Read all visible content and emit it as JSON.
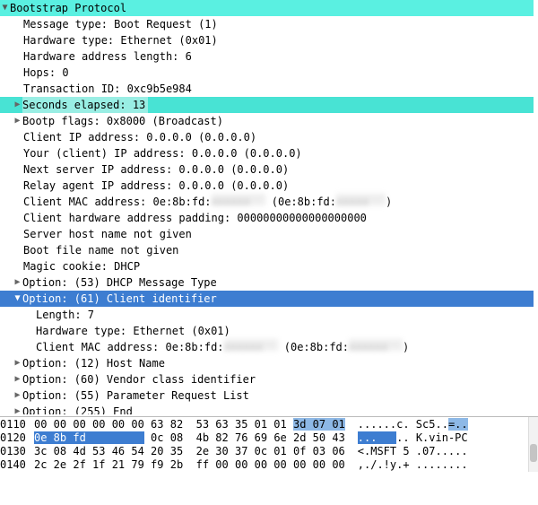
{
  "tree": {
    "header": "Bootstrap Protocol",
    "l1": "Message type: Boot Request (1)",
    "l2": "Hardware type: Ethernet (0x01)",
    "l3": "Hardware address length: 6",
    "l4": "Hops: 0",
    "l5": "Transaction ID: 0xc9b5e984",
    "l6": "Seconds elapsed: 13",
    "l7": "Bootp flags: 0x8000 (Broadcast)",
    "l8": "Client IP address: 0.0.0.0 (0.0.0.0)",
    "l9": "Your (client) IP address: 0.0.0.0 (0.0.0.0)",
    "l10": "Next server IP address: 0.0.0.0 (0.0.0.0)",
    "l11": "Relay agent IP address: 0.0.0.0 (0.0.0.0)",
    "l12a": "Client MAC address: 0e:8b:fd:",
    "l12b": " (0e:8b:fd:",
    "l12c": ")",
    "l13": "Client hardware address padding: 00000000000000000000",
    "l14": "Server host name not given",
    "l15": "Boot file name not given",
    "l16": "Magic cookie: DHCP",
    "l17": "Option: (53) DHCP Message Type",
    "l18": "Option: (61) Client identifier",
    "l19": "Length: 7",
    "l20": "Hardware type: Ethernet (0x01)",
    "l21a": "Client MAC address: 0e:8b:fd:",
    "l21b": " (0e:8b:fd:",
    "l21c": ")",
    "l22": "Option: (12) Host Name",
    "l23": "Option: (60) Vendor class identifier",
    "l24": "Option: (55) Parameter Request List",
    "l25": "Option: (255) End"
  },
  "hex": {
    "r1": {
      "off": "0110",
      "b_pre": "00 00 00 00 00 00 63 82  53 63 35 01 01 ",
      "b_sel": "3d 07 01",
      "asc_pre": "......c. Sc5..",
      "asc_sel": "=.."
    },
    "r2": {
      "off": "0120",
      "b_sel": "0e 8b fd         ",
      "b_post": " 0c 08  4b 82 76 69 6e 2d 50 43",
      "asc_sel": "...   ",
      "asc_post": ".. K.vin-PC"
    },
    "r3": {
      "off": "0130",
      "b": "3c 08 4d 53 46 54 20 35  2e 30 37 0c 01 0f 03 06",
      "asc": "<.MSFT 5 .07....."
    },
    "r4": {
      "off": "0140",
      "b": "2c 2e 2f 1f 21 79 f9 2b  ff 00 00 00 00 00 00 00",
      "asc": ",./.!y.+ ........"
    }
  }
}
